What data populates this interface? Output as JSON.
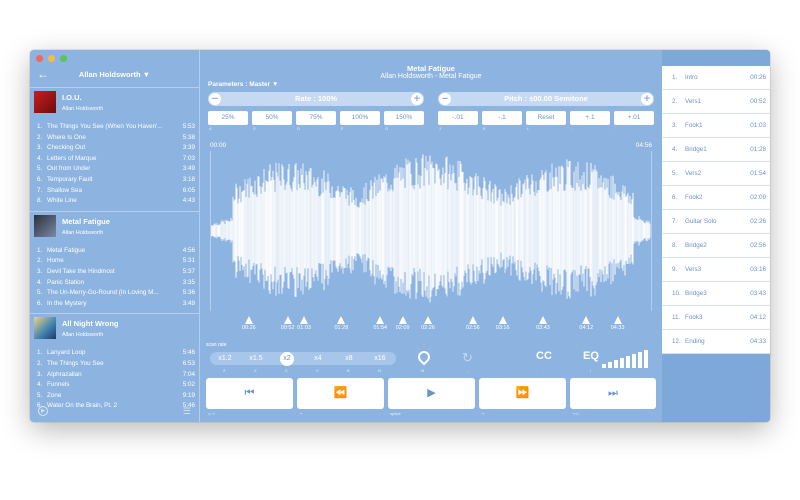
{
  "left": {
    "artist": "Allan Holdsworth ▼",
    "albums": [
      {
        "name": "I.O.U.",
        "artist": "Allan Holdsworth",
        "tracks": [
          {
            "n": "1.",
            "t": "The Things You See (When You Haven'...",
            "d": "5:53"
          },
          {
            "n": "2.",
            "t": "Where Is One",
            "d": "5:38"
          },
          {
            "n": "3.",
            "t": "Checking Out",
            "d": "3:39"
          },
          {
            "n": "4.",
            "t": "Letters of Marque",
            "d": "7:03"
          },
          {
            "n": "5.",
            "t": "Out from Under",
            "d": "3:49"
          },
          {
            "n": "6.",
            "t": "Temporary Fault",
            "d": "3:18"
          },
          {
            "n": "7.",
            "t": "Shallow Sea",
            "d": "6:05"
          },
          {
            "n": "8.",
            "t": "White Line",
            "d": "4:43"
          }
        ]
      },
      {
        "name": "Metal Fatigue",
        "artist": "Allan Holdsworth",
        "tracks": [
          {
            "n": "1.",
            "t": "Metal Fatigue",
            "d": "4:56"
          },
          {
            "n": "2.",
            "t": "Home",
            "d": "5:31"
          },
          {
            "n": "3.",
            "t": "Devil Take the Hindmost",
            "d": "5:37"
          },
          {
            "n": "4.",
            "t": "Panic Station",
            "d": "3:35"
          },
          {
            "n": "5.",
            "t": "The Un-Merry-Go-Round (In Loving M...",
            "d": "5:36"
          },
          {
            "n": "6.",
            "t": "In the Mystery",
            "d": "3:49"
          }
        ]
      },
      {
        "name": "All Night Wrong",
        "artist": "Allan Holdsworth",
        "tracks": [
          {
            "n": "1.",
            "t": "Lanyard Loop",
            "d": "5:46"
          },
          {
            "n": "2.",
            "t": "The Things You See",
            "d": "6:53"
          },
          {
            "n": "3.",
            "t": "Alphrazallan",
            "d": "7:04"
          },
          {
            "n": "4.",
            "t": "Funnels",
            "d": "5:02"
          },
          {
            "n": "5.",
            "t": "Zone",
            "d": "9:19"
          },
          {
            "n": "6.",
            "t": "Water On the Brain, Pt. 2",
            "d": "5:46"
          }
        ]
      }
    ]
  },
  "center": {
    "title": "Metal Fatigue",
    "subtitle": "Allan Holdsworth - Metal Fatigue",
    "params": "Parameters : Master ▼",
    "rate_label": "Rate : 100%",
    "pitch_label": "Pitch : ±00.00 Semitone",
    "rate_buttons": [
      "25%",
      "50%",
      "75%",
      "100%",
      "150%"
    ],
    "rate_keys": [
      "A",
      "S",
      "D",
      "F",
      "G"
    ],
    "pitch_buttons": [
      "-.01",
      "-.1",
      "Reset",
      "+.1",
      "+.01"
    ],
    "pitch_keys": [
      "J",
      "K",
      "L",
      ";",
      "'"
    ],
    "time_start": "00:00",
    "time_end": "04:56",
    "markers": [
      "00:26",
      "00:52",
      "01:03",
      "01:28",
      "01:54",
      "02:09",
      "02:26",
      "02:56",
      "03:16",
      "03:43",
      "04:12",
      "04:33"
    ],
    "scan_label": "scan rate",
    "scan": [
      "x1.2",
      "x1.5",
      "x2",
      "x4",
      "x8",
      "x16"
    ],
    "scan_keys": [
      "Z",
      "X",
      "C",
      "V",
      "B",
      "N"
    ],
    "cc": "CC",
    "eq": "EQ",
    "tool_keys": [
      "M",
      ",",
      ".",
      "/"
    ],
    "ctrl_keys": {
      "k1": "⊂⊸",
      "k2": "⊸",
      "k3": "space",
      "k4": "⊸",
      "k5": "⊸⊃"
    }
  },
  "segments": [
    {
      "n": "1.",
      "name": "Intro",
      "t": "00:26"
    },
    {
      "n": "2.",
      "name": "Vers1",
      "t": "00:52"
    },
    {
      "n": "3.",
      "name": "Fook1",
      "t": "01:03"
    },
    {
      "n": "4.",
      "name": "Bridge1",
      "t": "01:28"
    },
    {
      "n": "5.",
      "name": "Vers2",
      "t": "01:54"
    },
    {
      "n": "6.",
      "name": "Fook2",
      "t": "02:09"
    },
    {
      "n": "7.",
      "name": "Guitar Solo",
      "t": "02:26"
    },
    {
      "n": "8.",
      "name": "Bridge2",
      "t": "02:56"
    },
    {
      "n": "9.",
      "name": "Vers3",
      "t": "03:16"
    },
    {
      "n": "10.",
      "name": "Bridge3",
      "t": "03:43"
    },
    {
      "n": "11.",
      "name": "Fook3",
      "t": "04:12"
    },
    {
      "n": "12.",
      "name": "Ending",
      "t": "04:33"
    }
  ],
  "colors": {
    "bg": "#8db3e0",
    "panel": "#7fa8da",
    "accent": "#ffffff"
  }
}
